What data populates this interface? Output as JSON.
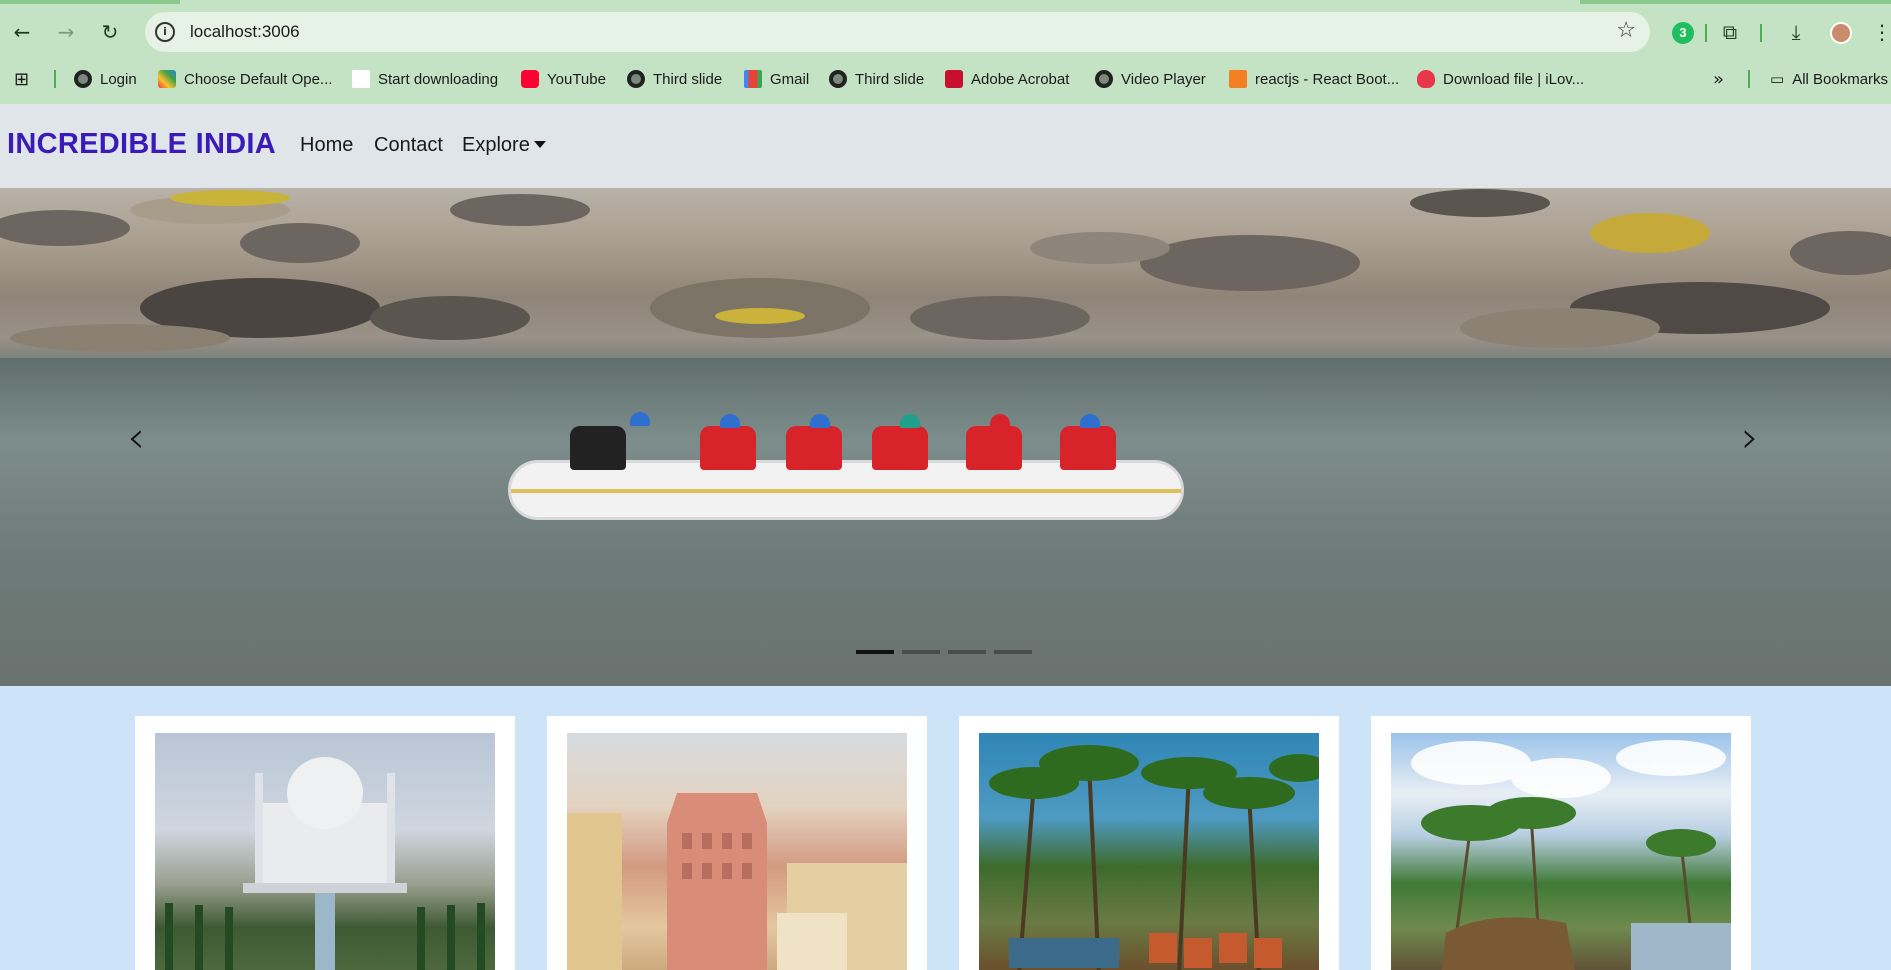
{
  "browser": {
    "url": "localhost:3006",
    "bookmarks": [
      {
        "label": "Login",
        "icon": "globe-icon"
      },
      {
        "label": "Choose Default Ope...",
        "icon": "site-icon"
      },
      {
        "label": "Start downloading",
        "icon": "blank-page-icon"
      },
      {
        "label": "YouTube",
        "icon": "youtube-icon"
      },
      {
        "label": "Third slide",
        "icon": "globe-icon"
      },
      {
        "label": "Gmail",
        "icon": "gmail-icon"
      },
      {
        "label": "Third slide",
        "icon": "globe-icon"
      },
      {
        "label": "Adobe Acrobat",
        "icon": "acrobat-icon"
      },
      {
        "label": "Video Player",
        "icon": "globe-icon"
      },
      {
        "label": "reactjs - React Boot...",
        "icon": "stackoverflow-icon"
      },
      {
        "label": "Download file | iLov...",
        "icon": "heart-icon"
      }
    ],
    "all_bookmarks_label": "All Bookmarks",
    "extension_badge": "3"
  },
  "navbar": {
    "brand": "INCREDIBLE INDIA",
    "links": [
      {
        "label": "Home"
      },
      {
        "label": "Contact"
      },
      {
        "label": "Explore"
      }
    ]
  },
  "carousel": {
    "slide_count": 4,
    "active_index": 0,
    "prev_icon": "chevron-left-icon",
    "next_icon": "chevron-right-icon"
  },
  "cards": [
    {
      "name": "taj-mahal"
    },
    {
      "name": "hawa-mahal"
    },
    {
      "name": "palm-beach"
    },
    {
      "name": "kerala-backwaters"
    }
  ],
  "colors": {
    "brand": "#3a1ab8",
    "chrome": "#c4e2c4",
    "navbar_bg": "#e0e5e9",
    "page_bg": "#cde3f7"
  }
}
